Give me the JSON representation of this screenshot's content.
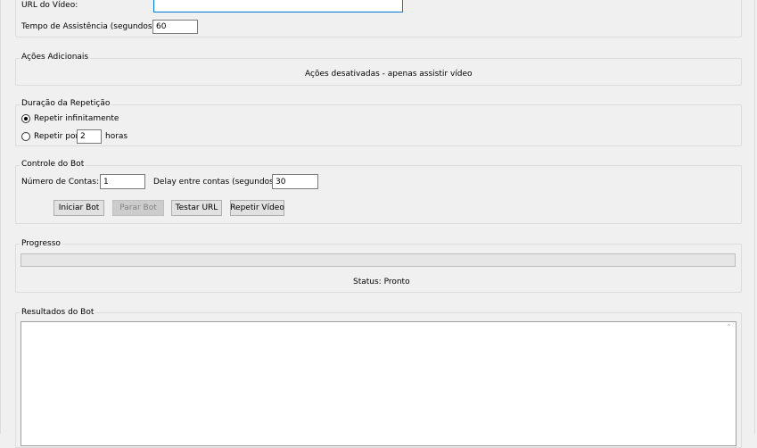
{
  "video": {
    "url_label": "URL do Vídeo:",
    "url_value": "",
    "watch_time_label": "Tempo de Assistência (segundos):",
    "watch_time_value": "60"
  },
  "additional_actions": {
    "title": "Ações Adicionais",
    "message": "Ações desativadas - apenas assistir vídeo"
  },
  "repeat_duration": {
    "title": "Duração da Repetição",
    "option_infinite": "Repetir infinitamente",
    "option_for_label": "Repetir por",
    "option_for_value": "2",
    "option_for_unit": "horas",
    "selected": "infinite"
  },
  "bot_control": {
    "title": "Controle do Bot",
    "accounts_label": "Número de Contas:",
    "accounts_value": "1",
    "delay_label": "Delay entre contas (segundos):",
    "delay_value": "30",
    "buttons": {
      "start": "Iniciar Bot",
      "stop": "Parar Bot",
      "test_url": "Testar URL",
      "repeat_video": "Repetir Vídeo"
    }
  },
  "progress": {
    "title": "Progresso",
    "value": 0,
    "status": "Status: Pronto"
  },
  "results": {
    "title": "Resultados do Bot",
    "text": ""
  },
  "colors": {
    "background": "#f0f0f0",
    "focus_border": "#0078d7",
    "progress_fill": "#06b025"
  }
}
